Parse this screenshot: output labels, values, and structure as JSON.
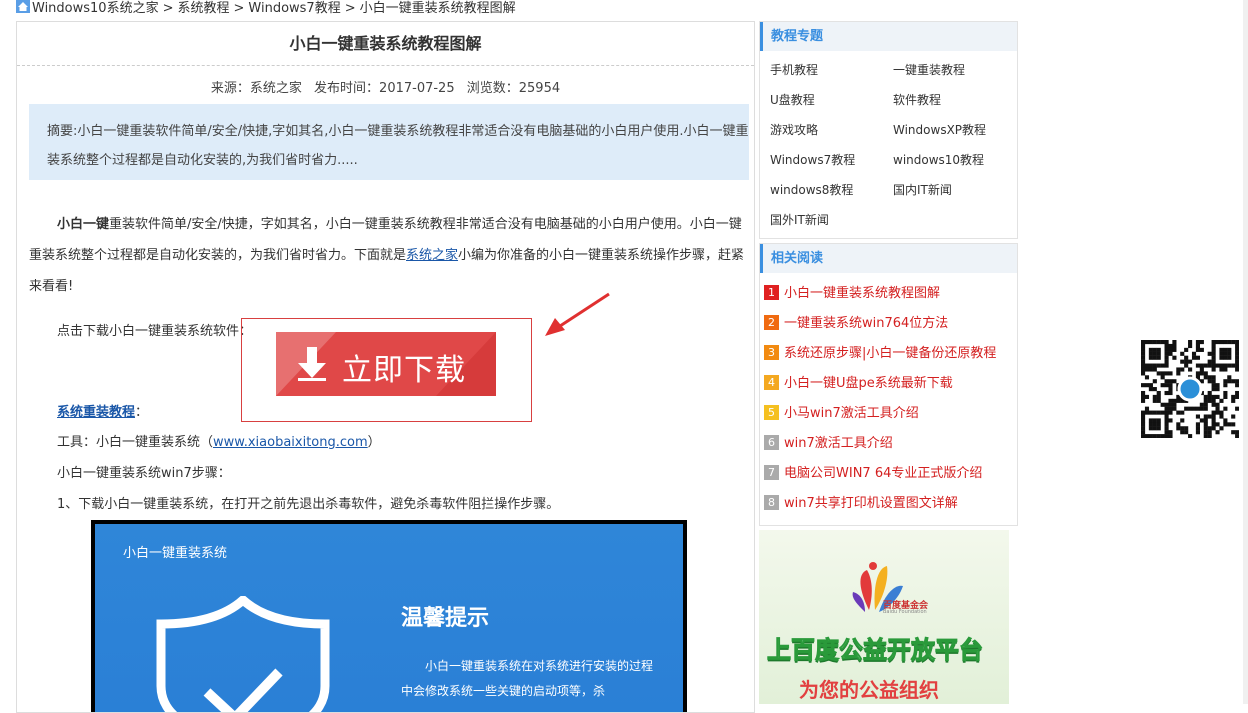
{
  "breadcrumb": {
    "items": [
      "Windows10系统之家",
      "系统教程",
      "Windows7教程",
      "小白一键重装系统教程图解"
    ],
    "separator": ">"
  },
  "article": {
    "title": "小白一键重装系统教程图解",
    "meta": {
      "source_label": "来源：",
      "source": "系统之家",
      "date_label": "发布时间：",
      "date": "2017-07-25",
      "views_label": "浏览数：",
      "views": "25954"
    },
    "summary": "摘要:小白一键重装软件简单/安全/快捷,字如其名,小白一键重装系统教程非常适合没有电脑基础的小白用户使用.小白一键重装系统整个过程都是自动化安装的,为我们省时省力.....",
    "intro_bold": "小白一键",
    "intro_rest_1": "重装软件简单/安全/快捷，字如其名，小白一键重装系统教程非常适合没有电脑基础的小白用户使用。小白一键重装系统整个过程都是自动化安装的，为我们省时省力。下面就是",
    "intro_link": "系统之家",
    "intro_rest_2": "小编为你准备的小白一键重装系统操作步骤，赶紧来看看!",
    "download_prompt": "点击下载小白一键重装系统软件：",
    "download_button": "立即下载",
    "reinstall_link": "系统重装教程",
    "reinstall_suffix": "：",
    "tool_label": "工具：小白一键重装系统（",
    "tool_link": "www.xiaobaixitong.com",
    "tool_suffix": "）",
    "steps_heading": "小白一键重装系统win7步骤：",
    "step1": "1、下载小白一键重装系统，在打开之前先退出杀毒软件，避免杀毒软件阻拦操作步骤。"
  },
  "dialog": {
    "title": "小白一键重装系统",
    "heading": "温馨提示",
    "body": "小白一键重装系统在对系统进行安装的过程中会修改系统一些关键的启动项等，杀"
  },
  "sidebar": {
    "topics_title": "教程专题",
    "topics": [
      "手机教程",
      "一键重装教程",
      "U盘教程",
      "软件教程",
      "游戏攻略",
      "WindowsXP教程",
      "Windows7教程",
      "windows10教程",
      "windows8教程",
      "国内IT新闻",
      "国外IT新闻"
    ],
    "related_title": "相关阅读",
    "related": [
      {
        "rank": "1",
        "text": "小白一键重装系统教程图解"
      },
      {
        "rank": "2",
        "text": "一键重装系统win764位方法"
      },
      {
        "rank": "3",
        "text": "系统还原步骤|小白一键备份还原教程"
      },
      {
        "rank": "4",
        "text": "小白一键U盘pe系统最新下载"
      },
      {
        "rank": "5",
        "text": "小马win7激活工具介绍"
      },
      {
        "rank": "6",
        "text": "win7激活工具介绍"
      },
      {
        "rank": "7",
        "text": "电脑公司WIN7 64专业正式版介绍"
      },
      {
        "rank": "8",
        "text": "win7共享打印机设置图文详解"
      }
    ],
    "rank_colors": [
      "#e02020",
      "#f06a10",
      "#f28a10",
      "#f4a820",
      "#f5c020",
      "#aaaaaa",
      "#aaaaaa",
      "#aaaaaa"
    ]
  },
  "ad": {
    "org": "百度基金会",
    "org_en": "Baidu Foundation",
    "line1": "上百度公益开放平台",
    "line2": "为您的公益组织"
  },
  "colors": {
    "accent": "#3a8fe0",
    "download": "#e04848",
    "link_red": "#d42020"
  }
}
